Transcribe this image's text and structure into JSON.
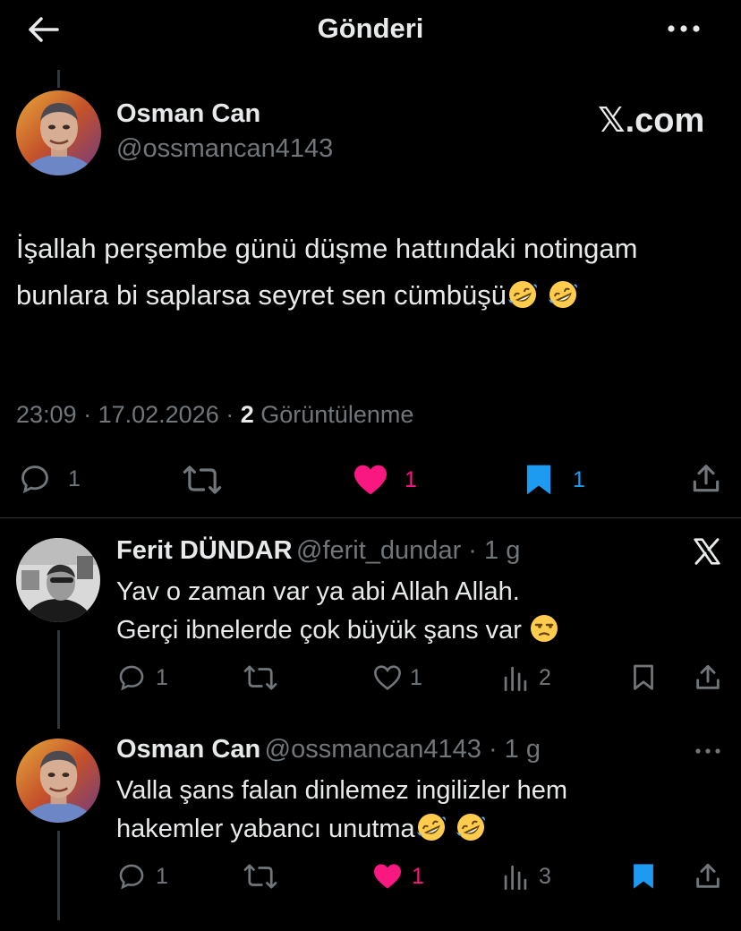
{
  "header": {
    "title": "Gönderi",
    "back_icon": "arrow-left-icon",
    "more_icon": "more-horizontal-icon"
  },
  "main_post": {
    "author_name": "Osman Can",
    "author_handle": "@ossmancan4143",
    "watermark": "𝕏.com",
    "text": "İşallah perşembe günü düşme hattındaki notingam bunlara bi saplarsa seyret sen cümbüşü",
    "emoji": [
      "rolling-on-floor-laughing-emoji",
      "rolling-on-floor-laughing-emoji"
    ],
    "time": "23:09",
    "date": "17.02.2026",
    "views_count": "2",
    "views_label": "Görüntülenme",
    "replies": "1",
    "likes": "1",
    "bookmarks": "1"
  },
  "replies": [
    {
      "author_name": "Ferit DÜNDAR",
      "author_handle": "@ferit_dundar",
      "age": "1 g",
      "line1": "Yav o  zaman var ya abi Allah Allah.",
      "line2": "Gerçi ibnelerde çok büyük şans var",
      "emoji": "unamused-face-emoji",
      "replies": "1",
      "likes": "1",
      "views": "2",
      "liked": false,
      "bookmarked": false
    },
    {
      "author_name": "Osman Can",
      "author_handle": "@ossmancan4143",
      "age": "1 g",
      "line1": "Valla şans falan dinlemez ingilizler hem",
      "line2": "hakemler yabancı unutma",
      "emoji": "rolling-on-floor-laughing-emoji",
      "replies": "1",
      "likes": "1",
      "views": "3",
      "liked": true,
      "bookmarked": true
    }
  ],
  "colors": {
    "background": "#000000",
    "text": "#e7e9ea",
    "secondary": "#71767b",
    "like": "#f91880",
    "bookmark": "#1d9bf0",
    "divider": "#2f3336"
  }
}
